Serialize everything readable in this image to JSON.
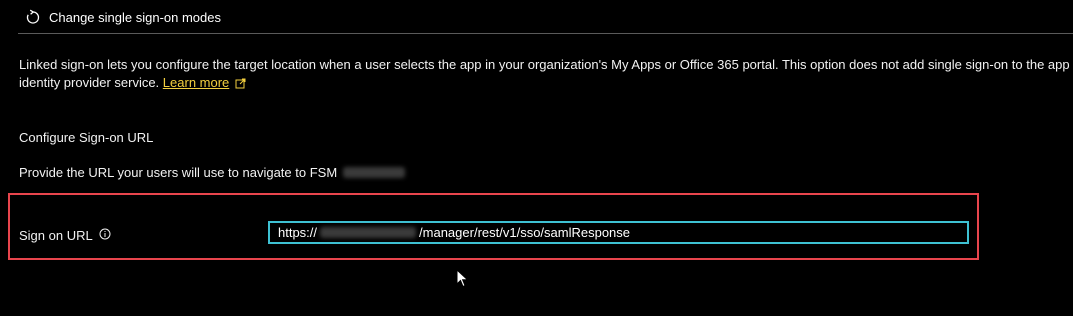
{
  "toolbar": {
    "change_modes_label": "Change single sign-on modes",
    "change_modes_icon": "undo-arrow-icon"
  },
  "description": {
    "line1": "Linked sign-on lets you configure the target location when a user selects the app in your organization's My Apps or Office 365 portal. This option does not add single sign-on to the app",
    "line2_prefix": "identity provider service.",
    "learn_more": "Learn more",
    "learn_more_icon": "external-link-icon",
    "link_color": "#f4d03f"
  },
  "config": {
    "title": "Configure Sign-on URL",
    "provide_text": "Provide the URL your users will use to navigate to FSM",
    "field_label": "Sign on URL",
    "info_icon": "info-icon",
    "url_prefix": "https://",
    "url_suffix": "/manager/rest/v1/sso/samlResponse"
  },
  "colors": {
    "highlight_border": "#e8454d",
    "input_focus_border": "#3ec1d3"
  }
}
